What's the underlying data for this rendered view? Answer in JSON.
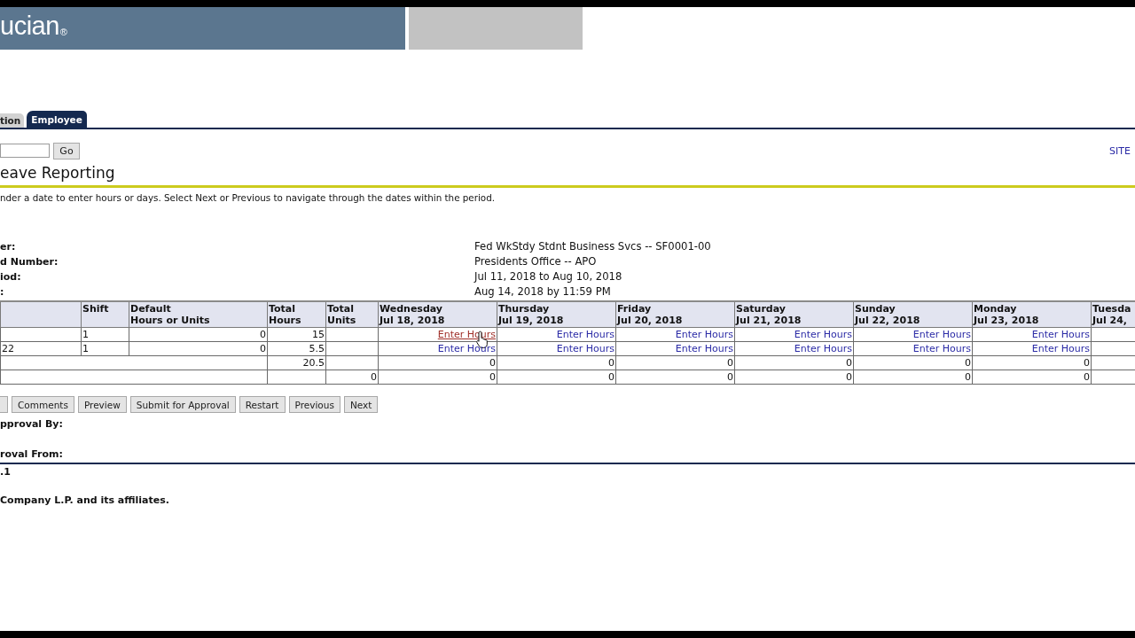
{
  "header": {
    "logo_text": "ucian",
    "logo_mark": "®"
  },
  "tabs": [
    {
      "label": "tion",
      "selected": false
    },
    {
      "label": "Employee",
      "selected": true
    }
  ],
  "search": {
    "button": "Go"
  },
  "site_link": "SITE",
  "page_title": "eave Reporting",
  "instructions": "nder a date to enter hours or days. Select Next or Previous to navigate through the dates within the period.",
  "details": [
    {
      "label": "er:",
      "value": "Fed WkStdy Stdnt Business Svcs -- SF0001-00"
    },
    {
      "label": "d Number:",
      "value": "Presidents Office -- APO"
    },
    {
      "label": "iod:",
      "value": "Jul 11, 2018 to Aug 10, 2018"
    },
    {
      "label": ":",
      "value": "Aug 14, 2018 by 11:59 PM"
    }
  ],
  "timesheet": {
    "columns": [
      {
        "lines": [
          "Shift"
        ]
      },
      {
        "lines": [
          "Default",
          "Hours or Units"
        ]
      },
      {
        "lines": [
          "Total",
          "Hours"
        ]
      },
      {
        "lines": [
          "Total",
          "Units"
        ]
      },
      {
        "lines": [
          "Wednesday",
          "Jul 18, 2018"
        ]
      },
      {
        "lines": [
          "Thursday",
          "Jul 19, 2018"
        ]
      },
      {
        "lines": [
          "Friday",
          "Jul 20, 2018"
        ]
      },
      {
        "lines": [
          "Saturday",
          "Jul 21, 2018"
        ]
      },
      {
        "lines": [
          "Sunday",
          "Jul 22, 2018"
        ]
      },
      {
        "lines": [
          "Monday",
          "Jul 23, 2018"
        ]
      },
      {
        "lines": [
          "Tuesda",
          "Jul 24,"
        ]
      }
    ],
    "entry_rows": [
      {
        "shift": "1",
        "default": "0",
        "total_hours": "15",
        "days": [
          {
            "link": "Enter Hours",
            "hovered": true
          },
          {
            "link": "Enter Hours",
            "hovered": false
          },
          {
            "link": "Enter Hours",
            "hovered": false
          },
          {
            "link": "Enter Hours",
            "hovered": false
          },
          {
            "link": "Enter Hours",
            "hovered": false
          },
          {
            "link": "Enter Hours",
            "hovered": false
          }
        ]
      },
      {
        "label": "22",
        "shift": "1",
        "default": "0",
        "total_hours": "5.5",
        "days": [
          {
            "link": "Enter Hours",
            "hovered": false
          },
          {
            "link": "Enter Hours",
            "hovered": false
          },
          {
            "link": "Enter Hours",
            "hovered": false
          },
          {
            "link": "Enter Hours",
            "hovered": false
          },
          {
            "link": "Enter Hours",
            "hovered": false
          },
          {
            "link": "Enter Hours",
            "hovered": false
          }
        ]
      }
    ],
    "total_rows": [
      {
        "total_hours": "20.5",
        "days": [
          "0",
          "0",
          "0",
          "0",
          "0",
          "0"
        ]
      },
      {
        "total_units": "0",
        "days": [
          "0",
          "0",
          "0",
          "0",
          "0",
          "0"
        ]
      }
    ]
  },
  "buttons": [
    {
      "kind": "clipped"
    },
    {
      "kind": "button",
      "label": "Comments"
    },
    {
      "kind": "button",
      "label": "Preview"
    },
    {
      "kind": "button",
      "label": "Submit for Approval"
    },
    {
      "kind": "button",
      "label": "Restart"
    },
    {
      "kind": "button",
      "label": "Previous"
    },
    {
      "kind": "button",
      "label": "Next"
    }
  ],
  "approval": [
    {
      "label": "pproval By:"
    },
    {
      "label": "roval From:"
    }
  ],
  "footer": {
    "version": ".1",
    "copyright": "Company L.P. and its affiliates."
  }
}
